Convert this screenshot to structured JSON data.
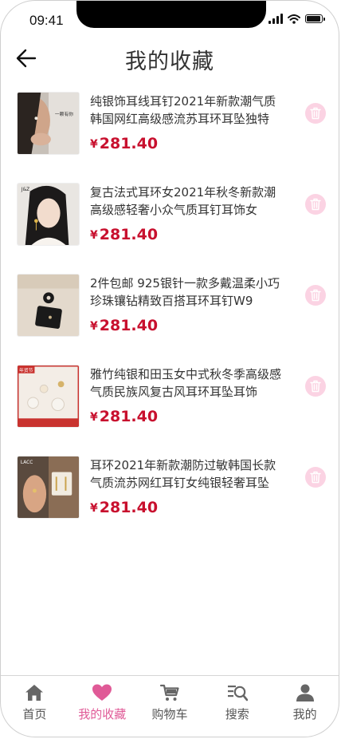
{
  "status_bar": {
    "time": "09:41"
  },
  "header": {
    "title": "我的收藏"
  },
  "favorites": [
    {
      "title": "纯银饰耳线耳钉2021年新款潮气质韩国网红高级感流苏耳环耳坠独特",
      "currency": "¥",
      "price": "281.40",
      "thumb_label": "一颗有你"
    },
    {
      "title": "复古法式耳环女2021年秋冬新款潮高级感轻奢小众气质耳钉耳饰女",
      "currency": "¥",
      "price": "281.40",
      "thumb_label": "J&Z"
    },
    {
      "title": "2件包邮 925银针一款多戴温柔小巧珍珠镶钻精致百搭耳环耳钉W9",
      "currency": "¥",
      "price": "281.40",
      "thumb_label": ""
    },
    {
      "title": "雅竹纯银和田玉女中式秋冬季高级感气质民族风复古风耳环耳坠耳饰",
      "currency": "¥",
      "price": "281.40",
      "thumb_label": "年货节"
    },
    {
      "title": "耳环2021年新款潮防过敏韩国长款气质流苏网红耳钉女纯银轻奢耳坠",
      "currency": "¥",
      "price": "281.40",
      "thumb_label": "LACC"
    }
  ],
  "tabs": [
    {
      "label": "首页",
      "icon": "home-icon",
      "active": false
    },
    {
      "label": "我的收藏",
      "icon": "heart-icon",
      "active": true
    },
    {
      "label": "购物车",
      "icon": "cart-icon",
      "active": false
    },
    {
      "label": "搜索",
      "icon": "search-icon",
      "active": false
    },
    {
      "label": "我的",
      "icon": "user-icon",
      "active": false
    }
  ],
  "colors": {
    "accent": "#e05a97",
    "price": "#c8102e",
    "delete_bg": "#fbd3e3",
    "tab_inactive": "#666666"
  }
}
